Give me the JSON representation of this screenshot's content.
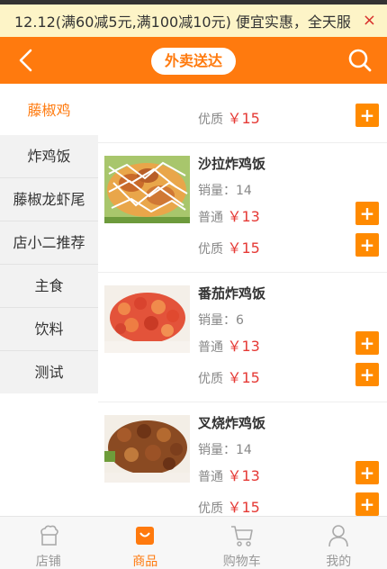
{
  "notice": {
    "text": "12.12(满60减5元,满100减10元)   便宜实惠，全天服",
    "close": "×"
  },
  "header": {
    "title": "外卖送达"
  },
  "sidebar": {
    "categories": [
      {
        "label": "藤椒鸡"
      },
      {
        "label": "炸鸡饭"
      },
      {
        "label": "藤椒龙虾尾"
      },
      {
        "label": "店小二推荐"
      },
      {
        "label": "主食"
      },
      {
        "label": "饮料"
      },
      {
        "label": "测试"
      }
    ]
  },
  "items": [
    {
      "premium_label": "优质",
      "premium_price": "￥15"
    },
    {
      "name": "沙拉炸鸡饭",
      "sales": "销量：14",
      "normal_label": "普通",
      "normal_price": "￥13",
      "premium_label": "优质",
      "premium_price": "￥15"
    },
    {
      "name": "番茄炸鸡饭",
      "sales": "销量：6",
      "normal_label": "普通",
      "normal_price": "￥13",
      "premium_label": "优质",
      "premium_price": "￥15"
    },
    {
      "name": "叉烧炸鸡饭",
      "sales": "销量：14",
      "normal_label": "普通",
      "normal_price": "￥13",
      "premium_label": "优质",
      "premium_price": "￥15"
    }
  ],
  "add_symbol": "+",
  "tabbar": {
    "tabs": [
      {
        "label": "店铺",
        "icon": "shop-icon"
      },
      {
        "label": "商品",
        "icon": "goods-icon"
      },
      {
        "label": "购物车",
        "icon": "cart-icon"
      },
      {
        "label": "我的",
        "icon": "user-icon"
      }
    ]
  },
  "colors": {
    "brand": "#ff7a0e",
    "price": "#e53935",
    "notice_bg": "#fdf4c7"
  }
}
